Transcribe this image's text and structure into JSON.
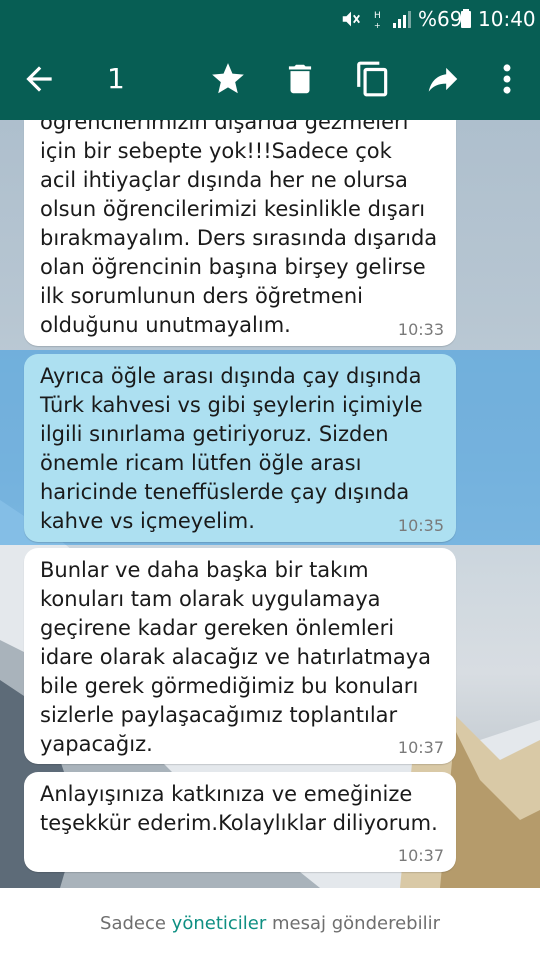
{
  "status_bar": {
    "battery": "%69",
    "time": "10:40",
    "icons": [
      "mute-icon",
      "hplus-signal-icon",
      "cell-signal-icon",
      "battery-icon"
    ]
  },
  "toolbar": {
    "selected_count": "1",
    "icons": [
      "back-arrow-icon",
      "star-icon",
      "delete-icon",
      "copy-icon",
      "forward-icon",
      "more-vert-icon"
    ]
  },
  "colors": {
    "header_bg": "#075e54",
    "selected_bubble": "#ade0f1",
    "admin_link": "#0e8f82"
  },
  "messages": [
    {
      "text": "öğrencilerimizin dışarıda gezmeleri\niçin bir sebepte yok!!!Sadece çok\nacil ihtiyaçlar dışında her ne olursa\nolsun öğrencilerimizi kesinlikle dışarı\nbırakmayalım. Ders sırasında dışarıda\nolan öğrencinin başına birşey gelirse\nilk sorumlunun ders öğretmeni\nolduğunu unutmayalım.",
      "time": "10:33",
      "selected": false
    },
    {
      "text": "Ayrıca öğle arası dışında çay dışında\nTürk kahvesi vs gibi şeylerin içimiyle\nilgili sınırlama getiriyoruz. Sizden\nönemle ricam lütfen öğle arası\nharicinde teneffüslerde çay dışında\nkahve vs içmeyelim.",
      "time": "10:35",
      "selected": true
    },
    {
      "text": "Bunlar ve daha başka bir takım\nkonuları tam olarak uygulamaya\ngeçirene kadar gereken önlemleri\nidare olarak alacağız ve hatırlatmaya\nbile gerek görmediğimiz bu konuları\nsizlerle paylaşacağımız toplantılar\nyapacağız.",
      "time": "10:37",
      "selected": false
    },
    {
      "text": "Anlayışınıza katkınıza ve emeğinize\nteşekkür ederim.Kolaylıklar diliyorum.",
      "time": "10:37",
      "selected": false
    }
  ],
  "footer": {
    "prefix": "Sadece ",
    "admins": "yöneticiler",
    "suffix": " mesaj gönderebilir"
  }
}
